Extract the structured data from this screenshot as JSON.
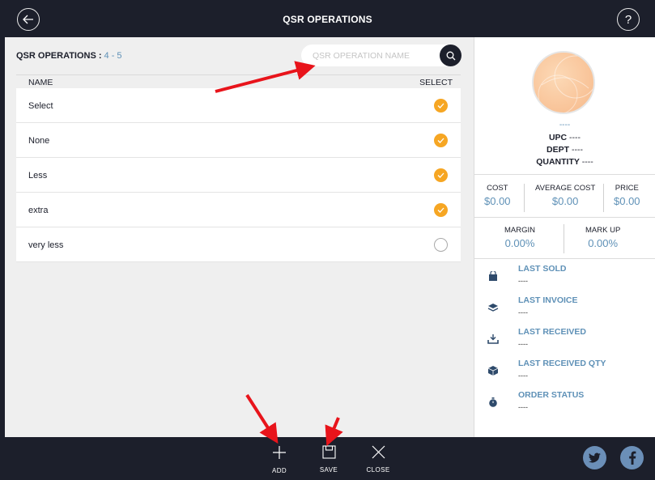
{
  "header": {
    "title": "QSR OPERATIONS",
    "back_icon": "back-arrow-icon",
    "help_icon": "help-icon"
  },
  "list": {
    "heading": "QSR OPERATIONS :",
    "range": "4 - 5",
    "search_placeholder": "QSR OPERATION NAME",
    "columns": {
      "name": "NAME",
      "select": "SELECT"
    },
    "rows": [
      {
        "name": "Select",
        "selected": true
      },
      {
        "name": "None",
        "selected": true
      },
      {
        "name": "Less",
        "selected": true
      },
      {
        "name": "extra",
        "selected": true
      },
      {
        "name": "very less",
        "selected": false
      }
    ]
  },
  "side": {
    "name": "----",
    "upc_label": "UPC",
    "upc_value": "----",
    "dept_label": "DEPT",
    "dept_value": "----",
    "qty_label": "QUANTITY",
    "qty_value": "----",
    "cost_label": "COST",
    "cost_value": "$0.00",
    "avg_cost_label": "AVERAGE COST",
    "avg_cost_value": "$0.00",
    "price_label": "PRICE",
    "price_value": "$0.00",
    "margin_label": "MARGIN",
    "margin_value": "0.00%",
    "markup_label": "MARK UP",
    "markup_value": "0.00%",
    "history": [
      {
        "label": "LAST SOLD",
        "value": "----",
        "icon": "bag-icon"
      },
      {
        "label": "LAST INVOICE",
        "value": "----",
        "icon": "layers-icon"
      },
      {
        "label": "LAST RECEIVED",
        "value": "----",
        "icon": "download-tray-icon"
      },
      {
        "label": "LAST RECEIVED QTY",
        "value": "----",
        "icon": "box-icon"
      },
      {
        "label": "ORDER STATUS",
        "value": "----",
        "icon": "timer-icon"
      }
    ]
  },
  "footer": {
    "add_label": "ADD",
    "save_label": "SAVE",
    "close_label": "CLOSE",
    "twitter_icon": "twitter-icon",
    "facebook_icon": "facebook-icon"
  },
  "colors": {
    "dark": "#1c1f2b",
    "accent": "#5f91b7",
    "check": "#f6a623",
    "arrow": "#e8141b"
  }
}
